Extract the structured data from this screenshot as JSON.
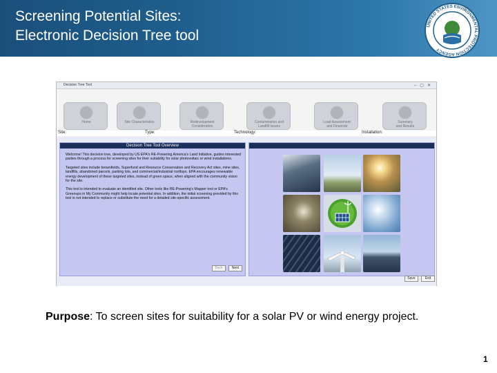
{
  "slide": {
    "title": "Screening Potential Sites:\nElectronic Decision Tree tool",
    "seal_text": "UNITED STATES ENVIRONMENTAL PROTECTION AGENCY",
    "page_number": "1",
    "purpose_label": "Purpose",
    "purpose_text": ": To screen sites for suitability for a solar PV or wind energy project.",
    "header_gradient": [
      "#1a4f7a",
      "#4e95c4"
    ]
  },
  "tool": {
    "window_title": "Decision Tree Tool",
    "nav": [
      {
        "label": "Home",
        "icon": "recycle-icon"
      },
      {
        "label": "Site Characteristics",
        "icon": "building-icon"
      },
      {
        "label": "Redevelopment\nConsideration",
        "icon": "network-icon"
      },
      {
        "label": "Contamination and\nLandfill Issues",
        "icon": "document-icon"
      },
      {
        "label": "Load Assessment\nand Financial",
        "icon": "chart-icon"
      },
      {
        "label": "Summary\nand Results",
        "icon": "gear-icon"
      }
    ],
    "info": {
      "site": "Site:",
      "type": "Type:",
      "technology": "Technology:",
      "installation": "Installation:"
    },
    "overview": {
      "heading": "Decision Tree Tool Overview",
      "para1": "Welcome! This decision tree, developed by US EPA's RE-Powering America's Land Initiative, guides interested parties through a process for screening sites for their suitability for solar photovoltaic or wind installations.",
      "para2": "Targeted sites include brownfields, Superfund and Resource Conservation and Recovery Act sites, mine sites, landfills, abandoned parcels, parking lots, and commercial/industrial rooftops. EPA encourages renewable energy development of these targeted sites, instead of green space, when aligned with the community vision for the site.",
      "para3": "This tool is intended to evaluate an identified site. Other tools like RE-Powering's Mapper tool or EPA's Greenups in My Community might help locate potential sites. In addition, the initial screening provided by this tool is not intended to replace or substitute the need for a detailed site-specific assessment.",
      "back_label": "Back",
      "next_label": "Next"
    },
    "save_label": "Save",
    "exit_label": "Exit"
  }
}
